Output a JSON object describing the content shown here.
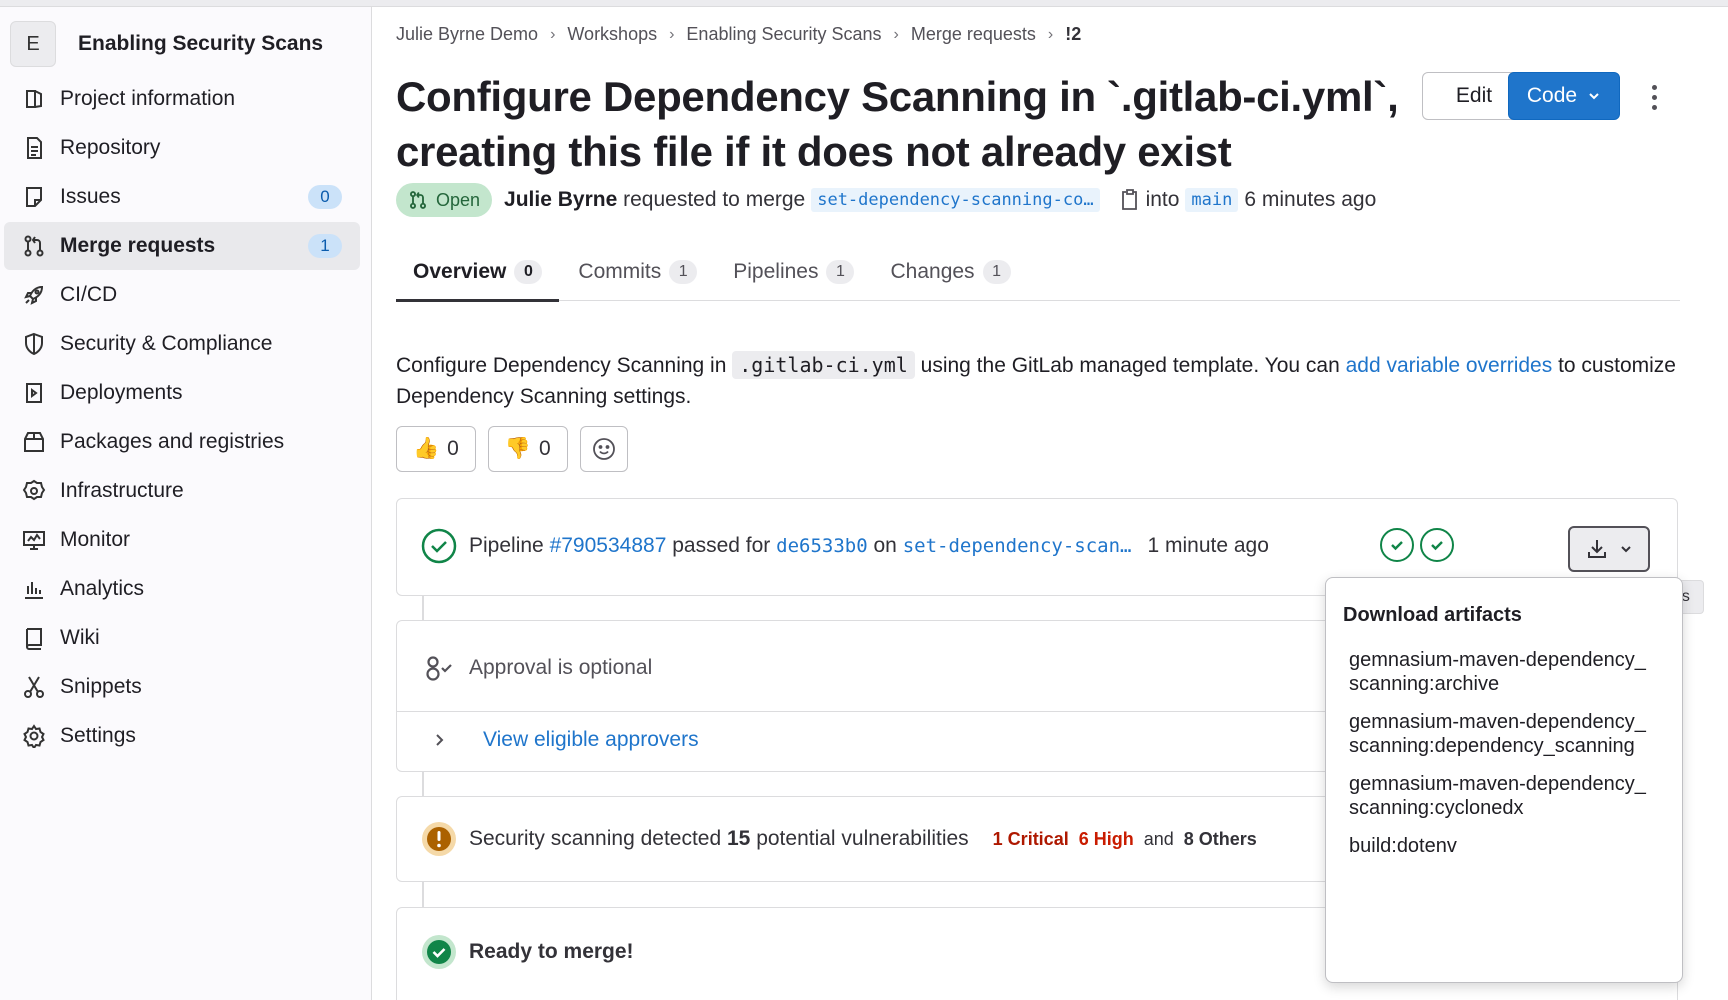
{
  "project": {
    "avatar_letter": "E",
    "name": "Enabling Security Scans"
  },
  "sidebar": {
    "items": [
      {
        "label": "Project information",
        "icon": "project-icon"
      },
      {
        "label": "Repository",
        "icon": "doc-icon"
      },
      {
        "label": "Issues",
        "icon": "issues-icon",
        "badge": "0"
      },
      {
        "label": "Merge requests",
        "icon": "merge-request-icon",
        "badge": "1",
        "active": true
      },
      {
        "label": "CI/CD",
        "icon": "rocket-icon"
      },
      {
        "label": "Security & Compliance",
        "icon": "shield-icon"
      },
      {
        "label": "Deployments",
        "icon": "deployments-icon"
      },
      {
        "label": "Packages and registries",
        "icon": "package-icon"
      },
      {
        "label": "Infrastructure",
        "icon": "cloud-gear-icon"
      },
      {
        "label": "Monitor",
        "icon": "monitor-icon"
      },
      {
        "label": "Analytics",
        "icon": "chart-icon"
      },
      {
        "label": "Wiki",
        "icon": "book-icon"
      },
      {
        "label": "Snippets",
        "icon": "scissors-icon"
      },
      {
        "label": "Settings",
        "icon": "gear-icon"
      }
    ]
  },
  "breadcrumbs": [
    "Julie Byrne Demo",
    "Workshops",
    "Enabling Security Scans",
    "Merge requests",
    "!2"
  ],
  "mr": {
    "title": "Configure Dependency Scanning in `.gitlab-ci.yml`, creating this file if it does not already exist",
    "edit_label": "Edit",
    "code_label": "Code",
    "status": "Open",
    "author": "Julie Byrne",
    "requested_text": "requested to merge",
    "source_branch": "set-dependency-scanning-co…",
    "into_text": "into",
    "target_branch": "main",
    "time": "6 minutes ago"
  },
  "tabs": [
    {
      "label": "Overview",
      "count": "0"
    },
    {
      "label": "Commits",
      "count": "1"
    },
    {
      "label": "Pipelines",
      "count": "1"
    },
    {
      "label": "Changes",
      "count": "1"
    }
  ],
  "description": {
    "p1": "Configure Dependency Scanning in ",
    "code": ".gitlab-ci.yml",
    "p2": " using the GitLab managed template. You can ",
    "link": "add variable overrides",
    "p3": " to customize Dependency Scanning settings."
  },
  "awards": {
    "thumbsup": "0",
    "thumbsdown": "0"
  },
  "pipeline": {
    "prefix": "Pipeline",
    "id": "#790534887",
    "passed_for": "passed for",
    "commit": "de6533b0",
    "on": "on",
    "branch": "set-dependency-scan…",
    "time": "1 minute ago"
  },
  "approval": {
    "text": "Approval is optional",
    "view_link": "View eligible approvers"
  },
  "security": {
    "text": "Security scanning detected",
    "count": "15",
    "suffix": "potential vulnerabilities",
    "critical": "1 Critical",
    "high": "6 High",
    "and": "and",
    "others": "8 Others"
  },
  "ready": {
    "text": "Ready to merge!"
  },
  "artifacts": {
    "tooltip": "Artifacts",
    "header": "Download artifacts",
    "items": [
      "gemnasium-maven-dependency_scanning:archive",
      "gemnasium-maven-dependency_scanning:dependency_scanning",
      "gemnasium-maven-dependency_scanning:cyclonedx",
      "build:dotenv"
    ]
  },
  "colors": {
    "primary": "#1f75cb",
    "success": "#108548",
    "warning": "#ab6100",
    "critical": "#ae1800"
  }
}
